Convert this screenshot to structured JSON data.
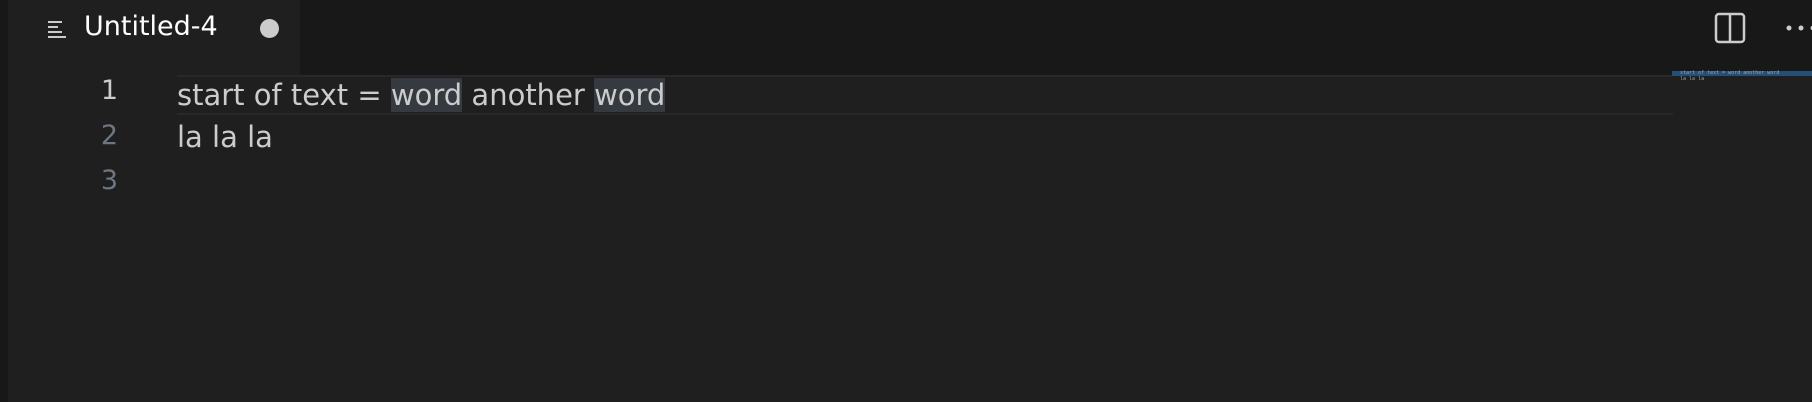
{
  "tab": {
    "title": "Untitled-4",
    "icon": "lines-icon",
    "dirty": true
  },
  "actions": {
    "split": "split-editor-icon",
    "more": "more-actions-icon"
  },
  "editor": {
    "lines": [
      {
        "number": "1",
        "parts": [
          "start of text = ",
          "word",
          " another ",
          "word"
        ]
      },
      {
        "number": "2",
        "parts": [
          "la la la"
        ]
      },
      {
        "number": "3",
        "parts": [
          ""
        ]
      }
    ],
    "active_line": 1,
    "highlight_word": "word"
  },
  "minimap": {
    "line1": "start of text = word another word",
    "line2": "la la la"
  },
  "colors": {
    "background": "#1f1f1f",
    "tabbar": "#181818",
    "text": "#cccccc",
    "line_number": "#6e7681",
    "word_highlight": "#343a40",
    "minimap_selection": "#264f78"
  }
}
